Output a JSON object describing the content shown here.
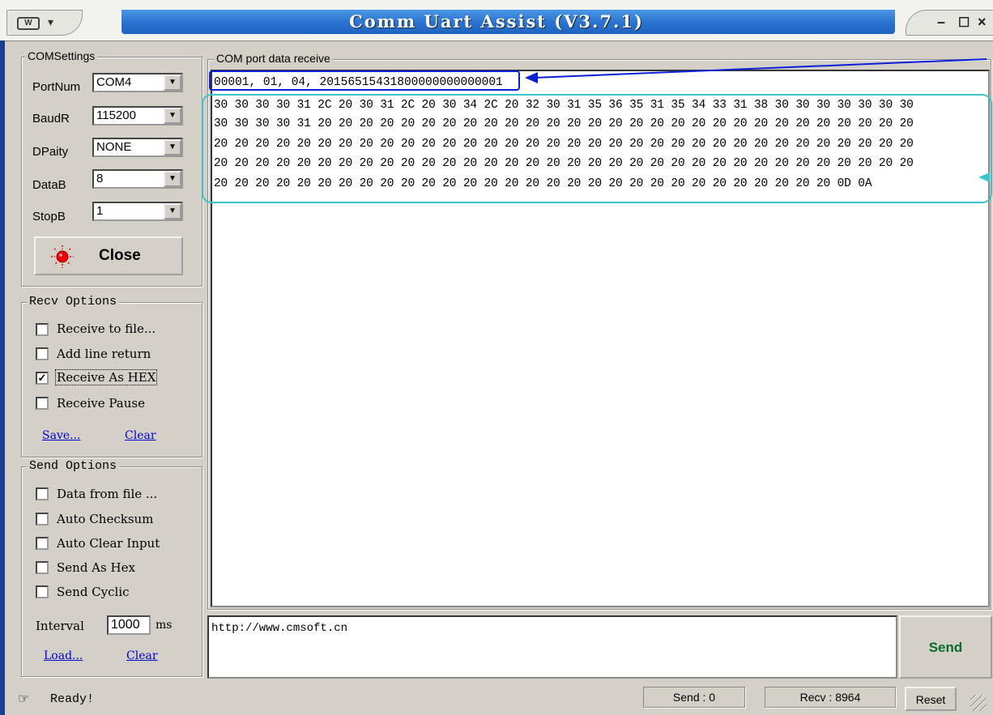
{
  "window": {
    "title": "Comm Uart Assist (V3.7.1)"
  },
  "com_settings": {
    "group_title": "COMSettings",
    "fields": [
      {
        "label": "PortNum",
        "value": "COM4"
      },
      {
        "label": "BaudR",
        "value": "115200"
      },
      {
        "label": "DPaity",
        "value": "NONE"
      },
      {
        "label": "DataB",
        "value": "8"
      },
      {
        "label": "StopB",
        "value": "1"
      }
    ],
    "close_label": "Close"
  },
  "recv_options": {
    "group_title": "Recv Options",
    "items": [
      {
        "label": "Receive to file...",
        "checked": false
      },
      {
        "label": "Add line return",
        "checked": false
      },
      {
        "label": "Receive As HEX",
        "checked": true
      },
      {
        "label": "Receive Pause",
        "checked": false
      }
    ],
    "save_link": "Save...",
    "clear_link": "Clear"
  },
  "send_options": {
    "group_title": "Send Options",
    "items": [
      {
        "label": "Data from file ...",
        "checked": false
      },
      {
        "label": "Auto Checksum",
        "checked": false
      },
      {
        "label": "Auto Clear Input",
        "checked": false
      },
      {
        "label": "Send As Hex",
        "checked": false
      },
      {
        "label": "Send Cyclic",
        "checked": false
      }
    ],
    "interval_label": "Interval",
    "interval_value": "1000",
    "interval_unit": "ms",
    "load_link": "Load...",
    "clear_link": "Clear"
  },
  "receive": {
    "group_title": "COM port data receive",
    "header_line": "00001, 01, 04, 20156515431800000000000001",
    "hex_lines": [
      "30 30 30 30 31 2C 20 30 31 2C 20 30 34 2C 20 32 30 31 35 36 35 31 35 34 33 31 38 30 30 30 30 30 30 30",
      "30 30 30 30 31 20 20 20 20 20 20 20 20 20 20 20 20 20 20 20 20 20 20 20 20 20 20 20 20 20 20 20 20 20",
      "20 20 20 20 20 20 20 20 20 20 20 20 20 20 20 20 20 20 20 20 20 20 20 20 20 20 20 20 20 20 20 20 20 20",
      "20 20 20 20 20 20 20 20 20 20 20 20 20 20 20 20 20 20 20 20 20 20 20 20 20 20 20 20 20 20 20 20 20 20",
      "20 20 20 20 20 20 20 20 20 20 20 20 20 20 20 20 20 20 20 20 20 20 20 20 20 20 20 20 20 20 0D 0A"
    ]
  },
  "send": {
    "input_text": "http://www.cmsoft.cn",
    "send_label": "Send"
  },
  "status_bar": {
    "status_text": "Ready!",
    "send_count": "Send : 0",
    "recv_count": "Recv : 8964",
    "reset_label": "Reset"
  },
  "colors": {
    "annotation_blue": "#0a1fd8",
    "annotation_teal": "#3cc4c8",
    "title_blue": "#2a72cf",
    "close_led": "#e00000"
  }
}
